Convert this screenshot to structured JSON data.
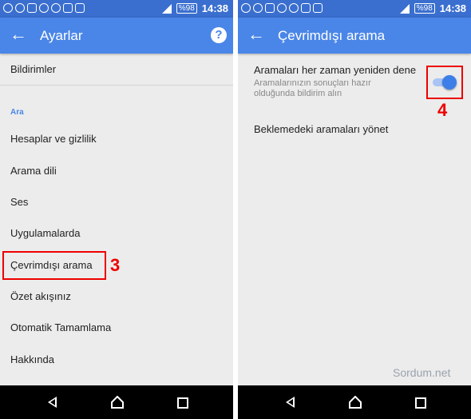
{
  "status": {
    "battery": "%98",
    "time": "14:38"
  },
  "left": {
    "title": "Ayarlar",
    "help_icon": "help-circle-icon",
    "items": [
      "Bildirimler",
      "Hesaplar ve gizlilik",
      "Arama dili",
      "Ses",
      "Uygulamalarda",
      "Çevrimdışı arama",
      "Özet akışınız",
      "Otomatik Tamamlama",
      "Hakkında"
    ],
    "section": "Ara",
    "annotation": "3"
  },
  "right": {
    "title": "Çevrimdışı arama",
    "retry_title": "Aramaları her zaman yeniden dene",
    "retry_subtitle": "Aramalarınızın sonuçları hazır olduğunda bildirim alın",
    "retry_toggle_on": true,
    "manage": "Beklemedeki aramaları yönet",
    "annotation": "4"
  },
  "watermark": "Sordum.net",
  "colors": {
    "appbar": "#4a86e8",
    "statusbar": "#3a6fcf",
    "toggle": "#3d7ee8",
    "highlight": "#e00000"
  }
}
